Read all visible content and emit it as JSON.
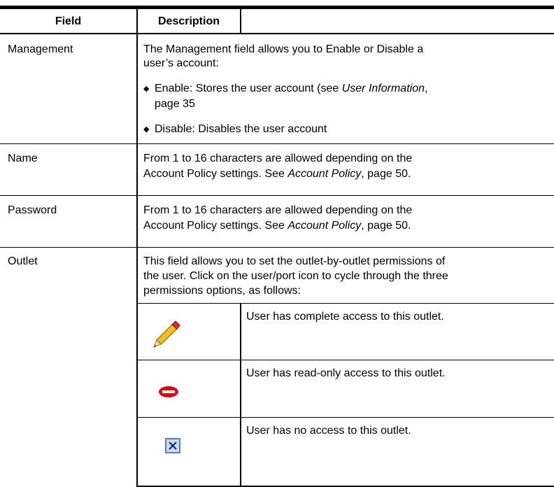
{
  "header": {
    "field": "Field",
    "description": "Description"
  },
  "rows": {
    "management": {
      "field": "Management",
      "desc_line1": "The Management field allows you to Enable or Disable a",
      "desc_line2": "user’s account:",
      "bullets": [
        {
          "line1_prefix": "Enable: Stores the user account (see ",
          "line1_italic": "User Information",
          "line1_suffix": ",",
          "line2": "page 35"
        },
        {
          "line1": "Disable: Disables the user account"
        }
      ]
    },
    "name": {
      "field": "Name",
      "line1": "From 1 to 16 characters are allowed depending on the",
      "line2_prefix": "Account Policy settings. See ",
      "line2_italic": "Account Policy",
      "line2_suffix": ", page 50."
    },
    "password": {
      "field": "Password",
      "line1": "From 1 to 16 characters are allowed depending on the",
      "line2_prefix": "Account Policy settings. See ",
      "line2_italic": "Account Policy",
      "line2_suffix": ", page 50."
    },
    "outlet": {
      "field": "Outlet",
      "line1": "This field allows you to set the outlet-by-outlet permissions of",
      "line2": "the user. Click on the user/port icon to cycle through the three",
      "line3": "permissions options, as follows:",
      "permissions": [
        {
          "icon": "pencil-icon",
          "text": "User has complete access to this outlet."
        },
        {
          "icon": "eye-icon",
          "text": "User has read-only access to this outlet."
        },
        {
          "icon": "x-box-icon",
          "text": "User has no access to this outlet."
        }
      ]
    }
  },
  "colors": {
    "rule": "#000000",
    "pencil": "#f0c020",
    "pencil_tip": "#e03020",
    "eye": "#e00010",
    "x_box_fill": "#c8dcf4",
    "x_box_border": "#5a7cb8"
  }
}
